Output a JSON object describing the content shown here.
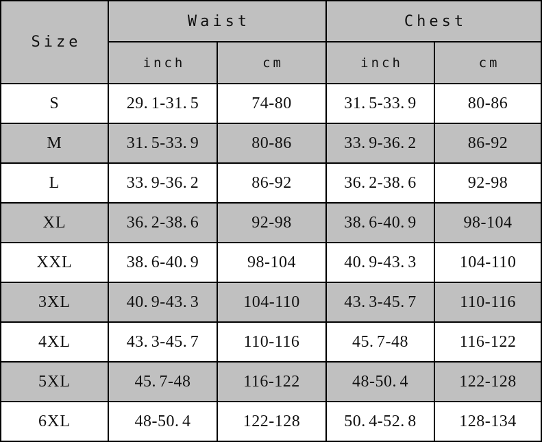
{
  "table": {
    "header": {
      "size_label": "Size",
      "groups": [
        {
          "label": "Waist",
          "units": [
            "inch",
            "cm"
          ]
        },
        {
          "label": "Chest",
          "units": [
            "inch",
            "cm"
          ]
        }
      ],
      "columns": [
        "Size",
        "Waist inch",
        "Waist cm",
        "Chest inch",
        "Chest cm"
      ]
    },
    "rows": [
      {
        "size": "S",
        "waist_inch": "29.1-31.5",
        "waist_cm": "74-80",
        "chest_inch": "31.5-33.9",
        "chest_cm": "80-86",
        "shade": "light"
      },
      {
        "size": "M",
        "waist_inch": "31.5-33.9",
        "waist_cm": "80-86",
        "chest_inch": "33.9-36.2",
        "chest_cm": "86-92",
        "shade": "dark"
      },
      {
        "size": "L",
        "waist_inch": "33.9-36.2",
        "waist_cm": "86-92",
        "chest_inch": "36.2-38.6",
        "chest_cm": "92-98",
        "shade": "light"
      },
      {
        "size": "XL",
        "waist_inch": "36.2-38.6",
        "waist_cm": "92-98",
        "chest_inch": "38.6-40.9",
        "chest_cm": "98-104",
        "shade": "dark"
      },
      {
        "size": "XXL",
        "waist_inch": "38.6-40.9",
        "waist_cm": "98-104",
        "chest_inch": "40.9-43.3",
        "chest_cm": "104-110",
        "shade": "light"
      },
      {
        "size": "3XL",
        "waist_inch": "40.9-43.3",
        "waist_cm": "104-110",
        "chest_inch": "43.3-45.7",
        "chest_cm": "110-116",
        "shade": "dark"
      },
      {
        "size": "4XL",
        "waist_inch": "43.3-45.7",
        "waist_cm": "110-116",
        "chest_inch": "45.7-48",
        "chest_cm": "116-122",
        "shade": "light"
      },
      {
        "size": "5XL",
        "waist_inch": "45.7-48",
        "waist_cm": "116-122",
        "chest_inch": "48-50.4",
        "chest_cm": "122-128",
        "shade": "dark"
      },
      {
        "size": "6XL",
        "waist_inch": "48-50.4",
        "waist_cm": "122-128",
        "chest_inch": "50.4-52.8",
        "chest_cm": "128-134",
        "shade": "light"
      }
    ]
  },
  "colors": {
    "header_fill": "#c0c0c0",
    "row_dark": "#c0c0c0",
    "row_light": "#ffffff",
    "border": "#000000",
    "text": "#111111"
  }
}
